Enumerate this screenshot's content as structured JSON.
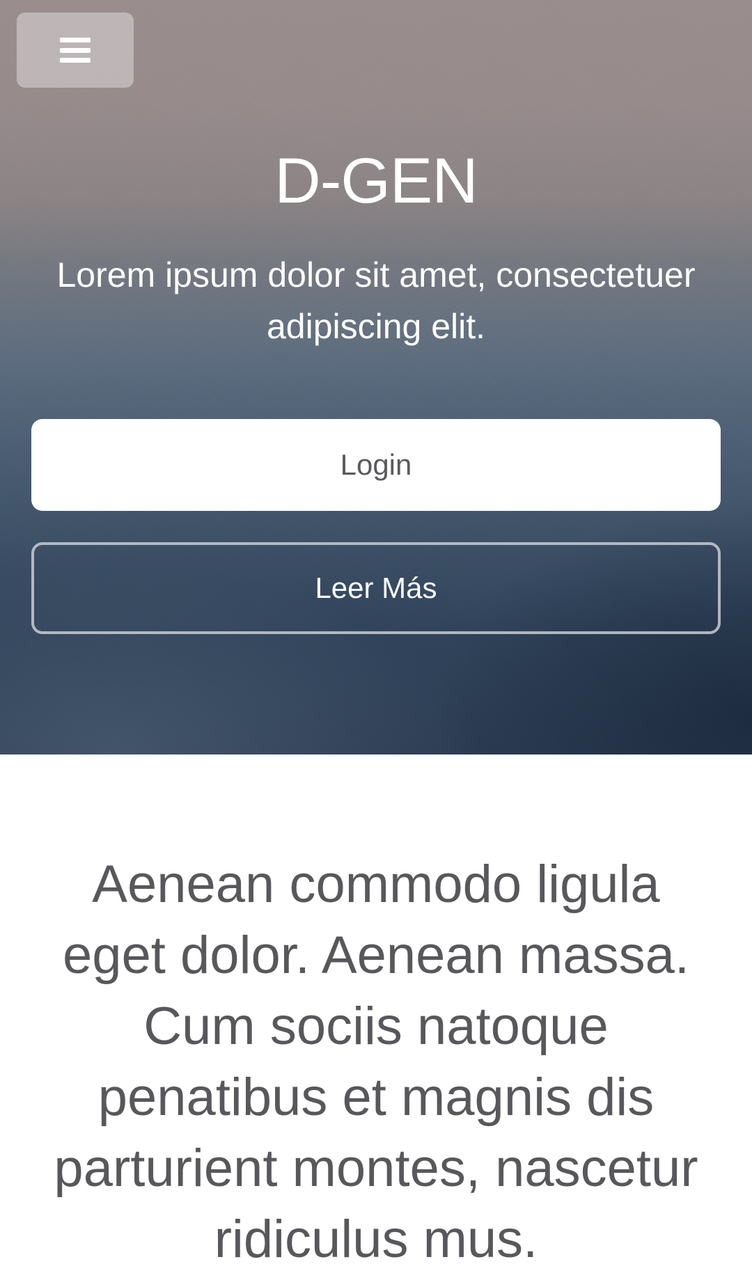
{
  "hero": {
    "title": "D-GEN",
    "subtitle": "Lorem ipsum dolor sit amet, consectetuer adipiscing elit.",
    "login_label": "Login",
    "more_label": "Leer Más",
    "menu_icon": "hamburger-icon"
  },
  "content": {
    "paragraph": "Aenean commodo ligula eget dolor. Aenean massa. Cum sociis natoque penatibus et magnis dis parturient montes, nascetur ridiculus mus."
  },
  "colors": {
    "hero_top": "#9a8d8e",
    "hero_bottom": "#2a3b52",
    "text_white": "#ffffff",
    "body_text": "#58585c"
  }
}
